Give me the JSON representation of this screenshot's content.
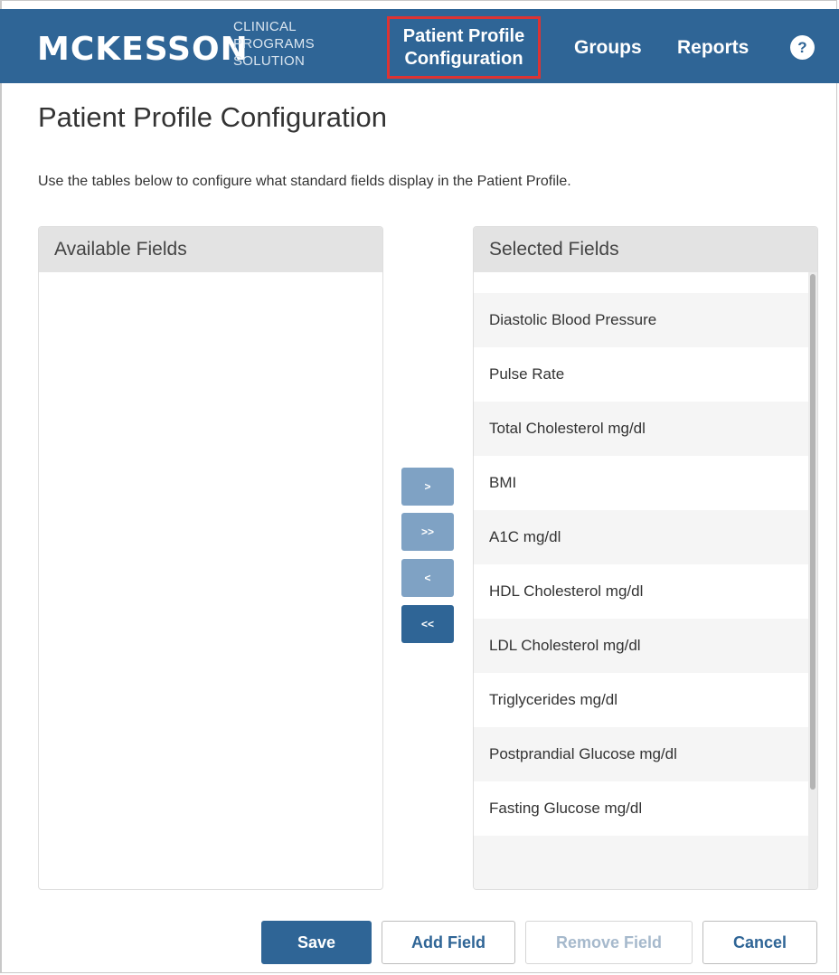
{
  "header": {
    "logo": "MCKESSON",
    "logo_sub_lines": [
      "CLINICAL",
      "PROGRAMS",
      "SOLUTION"
    ],
    "nav": {
      "active_line1": "Patient Profile",
      "active_line2": "Configuration",
      "groups": "Groups",
      "reports": "Reports",
      "help": "?"
    }
  },
  "page": {
    "title": "Patient Profile Configuration",
    "instructions": "Use the tables below to configure what standard fields display in the Patient Profile."
  },
  "available": {
    "title": "Available Fields",
    "items": []
  },
  "selected": {
    "title": "Selected Fields",
    "items": [
      "",
      "Diastolic Blood Pressure",
      "Pulse Rate",
      "Total Cholesterol mg/dl",
      "BMI",
      "A1C mg/dl",
      "HDL Cholesterol mg/dl",
      "LDL Cholesterol mg/dl",
      "Triglycerides mg/dl",
      "Postprandial Glucose mg/dl",
      "Fasting Glucose mg/dl",
      ""
    ]
  },
  "move_buttons": {
    "add": ">",
    "add_all": ">>",
    "remove": "<",
    "remove_all": "<<"
  },
  "actions": {
    "save": "Save",
    "add_field": "Add Field",
    "remove_field": "Remove Field",
    "cancel": "Cancel"
  },
  "colors": {
    "brand": "#2f6596",
    "highlight": "#dd3333",
    "disabled_text": "#a6b9cc"
  }
}
